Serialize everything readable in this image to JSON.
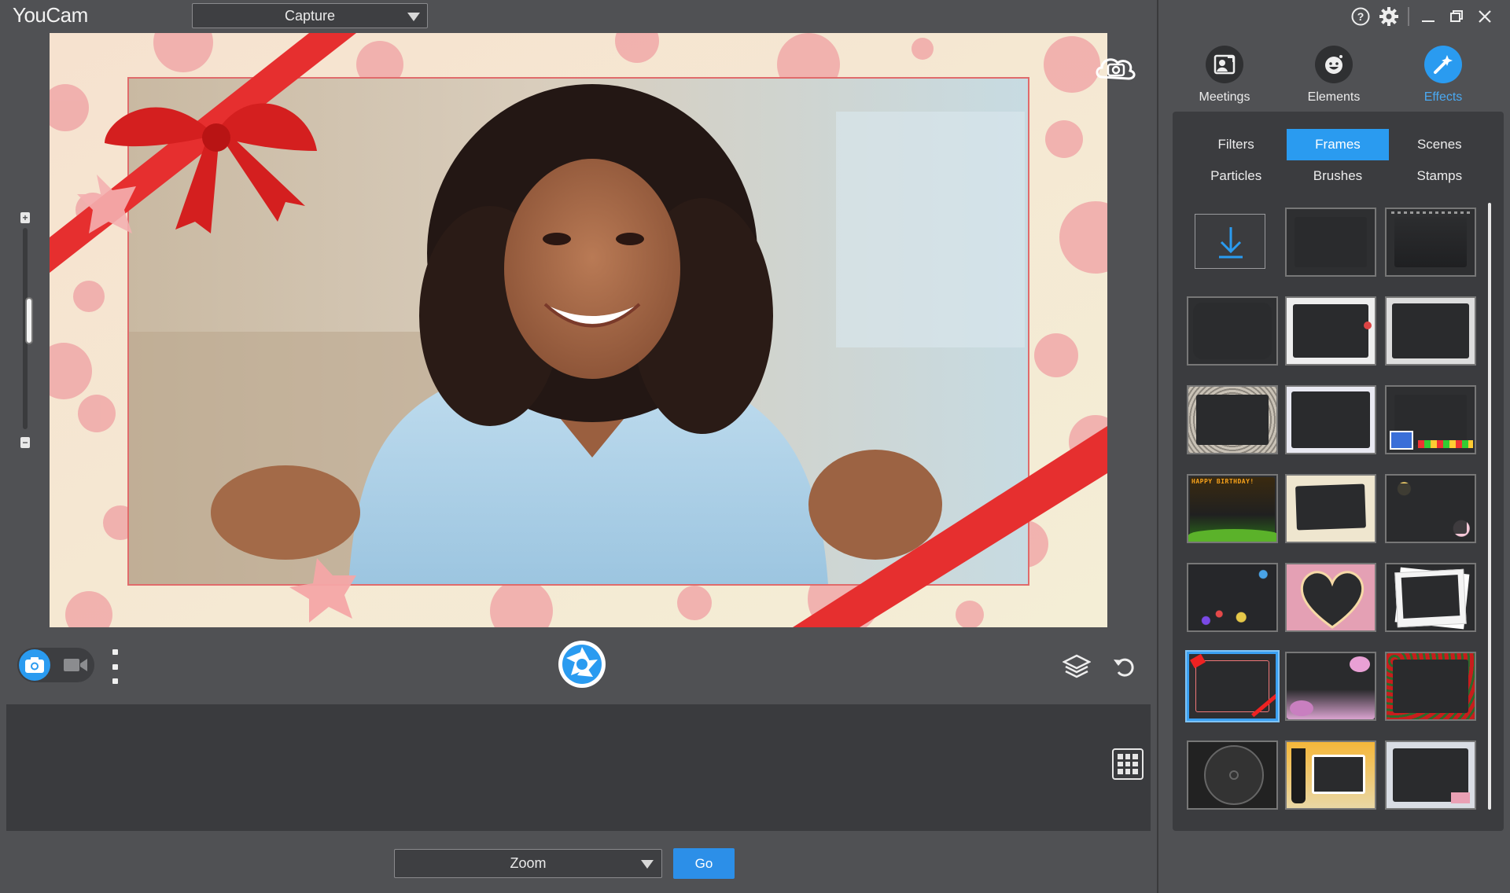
{
  "app": {
    "title": "YouCam"
  },
  "toolbar": {
    "mode_select": "Capture"
  },
  "zoom_slider": {
    "value": 0.55
  },
  "bottom_bar": {
    "app_select": "Zoom",
    "go_label": "Go"
  },
  "main_tabs": [
    {
      "label": "Meetings",
      "icon": "meetings-icon"
    },
    {
      "label": "Elements",
      "icon": "smiley-icon"
    },
    {
      "label": "Effects",
      "icon": "magic-wand-icon",
      "active": true
    }
  ],
  "sub_tabs": [
    {
      "label": "Filters"
    },
    {
      "label": "Frames",
      "active": true
    },
    {
      "label": "Scenes"
    },
    {
      "label": "Particles"
    },
    {
      "label": "Brushes"
    },
    {
      "label": "Stamps"
    }
  ],
  "frames": [
    {
      "name": "download"
    },
    {
      "name": "plain-gray"
    },
    {
      "name": "film-strip"
    },
    {
      "name": "rounded-dark"
    },
    {
      "name": "floral-corners"
    },
    {
      "name": "ink-splash"
    },
    {
      "name": "lace-border"
    },
    {
      "name": "snow-sparkle"
    },
    {
      "name": "gift-boxes"
    },
    {
      "name": "happy-birthday",
      "text": "HAPPY BIRTHDAY!"
    },
    {
      "name": "vintage-photo"
    },
    {
      "name": "bokeh-sparkle"
    },
    {
      "name": "colorful-dots"
    },
    {
      "name": "pink-heart"
    },
    {
      "name": "polaroid-stack"
    },
    {
      "name": "red-ribbon",
      "selected": true
    },
    {
      "name": "pink-blossoms"
    },
    {
      "name": "red-roses"
    },
    {
      "name": "target-circle"
    },
    {
      "name": "tropical-beach"
    },
    {
      "name": "postcard"
    }
  ],
  "colors": {
    "accent": "#2a9bf0",
    "background": "#505154",
    "panel": "#3b3c3f"
  }
}
